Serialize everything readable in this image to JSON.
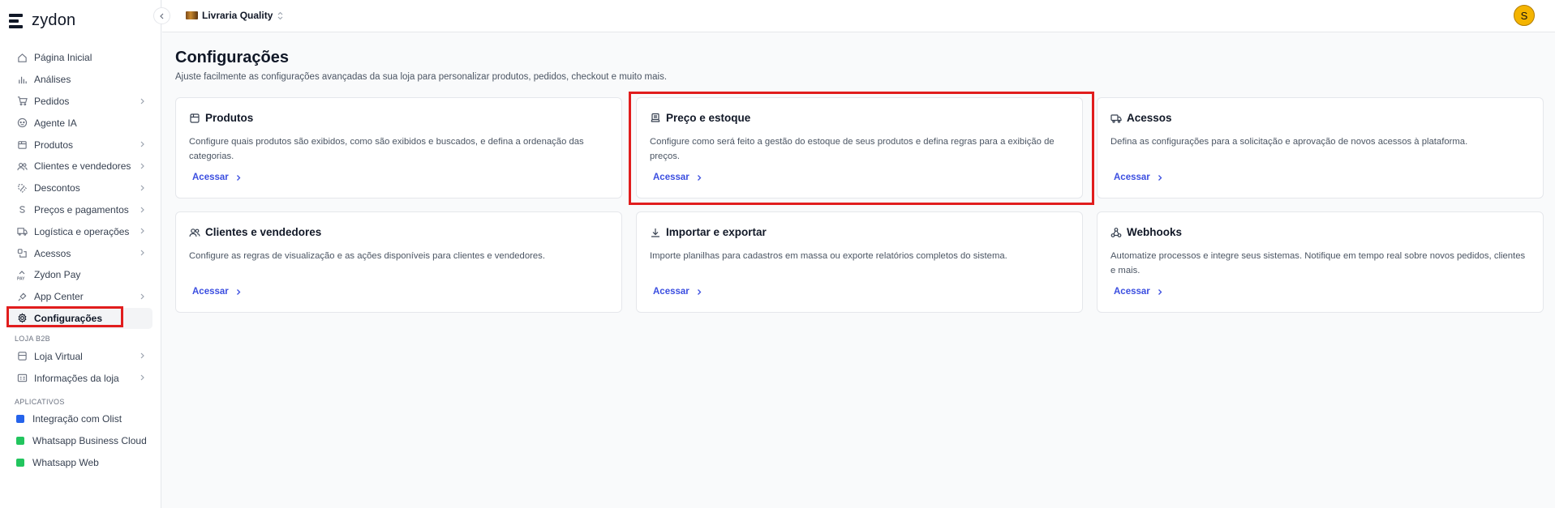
{
  "brand": {
    "name": "zydon"
  },
  "topbar": {
    "store_name": "Livraria Quality",
    "avatar_initial": "S"
  },
  "sidebar": {
    "items": [
      {
        "label": "Página Inicial",
        "icon": "home-icon",
        "chevron": false
      },
      {
        "label": "Análises",
        "icon": "chart-icon",
        "chevron": false
      },
      {
        "label": "Pedidos",
        "icon": "cart-icon",
        "chevron": true
      },
      {
        "label": "Agente IA",
        "icon": "bot-icon",
        "chevron": false
      },
      {
        "label": "Produtos",
        "icon": "box-icon",
        "chevron": true
      },
      {
        "label": "Clientes e vendedores",
        "icon": "users-icon",
        "chevron": true
      },
      {
        "label": "Descontos",
        "icon": "discount-icon",
        "chevron": true
      },
      {
        "label": "Preços e pagamentos",
        "icon": "dollar-icon",
        "chevron": true
      },
      {
        "label": "Logística e operações",
        "icon": "truck-icon",
        "chevron": true
      },
      {
        "label": "Acessos",
        "icon": "access-icon",
        "chevron": true
      },
      {
        "label": "Zydon Pay",
        "icon": "pay-icon",
        "chevron": false
      },
      {
        "label": "App Center",
        "icon": "plug-icon",
        "chevron": true
      },
      {
        "label": "Configurações",
        "icon": "gear-icon",
        "chevron": false,
        "active": true
      }
    ],
    "section_b2b": "LOJA B2B",
    "b2b_items": [
      {
        "label": "Loja Virtual",
        "icon": "store-icon",
        "chevron": true
      },
      {
        "label": "Informações da loja",
        "icon": "info-card-icon",
        "chevron": true
      }
    ],
    "section_apps": "APLICATIVOS",
    "apps": [
      {
        "label": "Integração com Olist",
        "color": "#2563eb"
      },
      {
        "label": "Whatsapp Business Cloud",
        "color": "#22c55e"
      },
      {
        "label": "Whatsapp Web",
        "color": "#22c55e"
      }
    ]
  },
  "main": {
    "title": "Configurações",
    "subtitle": "Ajuste facilmente as configurações avançadas da sua loja para personalizar produtos, pedidos, checkout e muito mais.",
    "cards": [
      {
        "title": "Produtos",
        "icon": "box-icon",
        "desc": "Configure quais produtos são exibidos, como são exibidos e buscados, e defina a ordenação das categorias.",
        "link": "Acessar"
      },
      {
        "title": "Preço e estoque",
        "icon": "register-icon",
        "desc": "Configure como será feito a gestão do estoque de seus produtos e defina regras para a exibição de preços.",
        "link": "Acessar"
      },
      {
        "title": "Acessos",
        "icon": "truck-access-icon",
        "desc": "Defina as configurações para a solicitação e aprovação de novos acessos à plataforma.",
        "link": "Acessar"
      },
      {
        "title": "Clientes e vendedores",
        "icon": "users-icon",
        "desc": "Configure as regras de visualização e as ações disponíveis para clientes e vendedores.",
        "link": "Acessar"
      },
      {
        "title": "Importar e exportar",
        "icon": "download-icon",
        "desc": "Importe planilhas para cadastros em massa ou exporte relatórios completos do sistema.",
        "link": "Acessar"
      },
      {
        "title": "Webhooks",
        "icon": "webhook-icon",
        "desc": "Automatize processos e integre seus sistemas. Notifique em tempo real sobre novos pedidos, clientes e mais.",
        "link": "Acessar"
      }
    ]
  },
  "colors": {
    "accent_link": "#3b4ee0",
    "highlight": "#e11d1d",
    "avatar": "#f4b400"
  }
}
